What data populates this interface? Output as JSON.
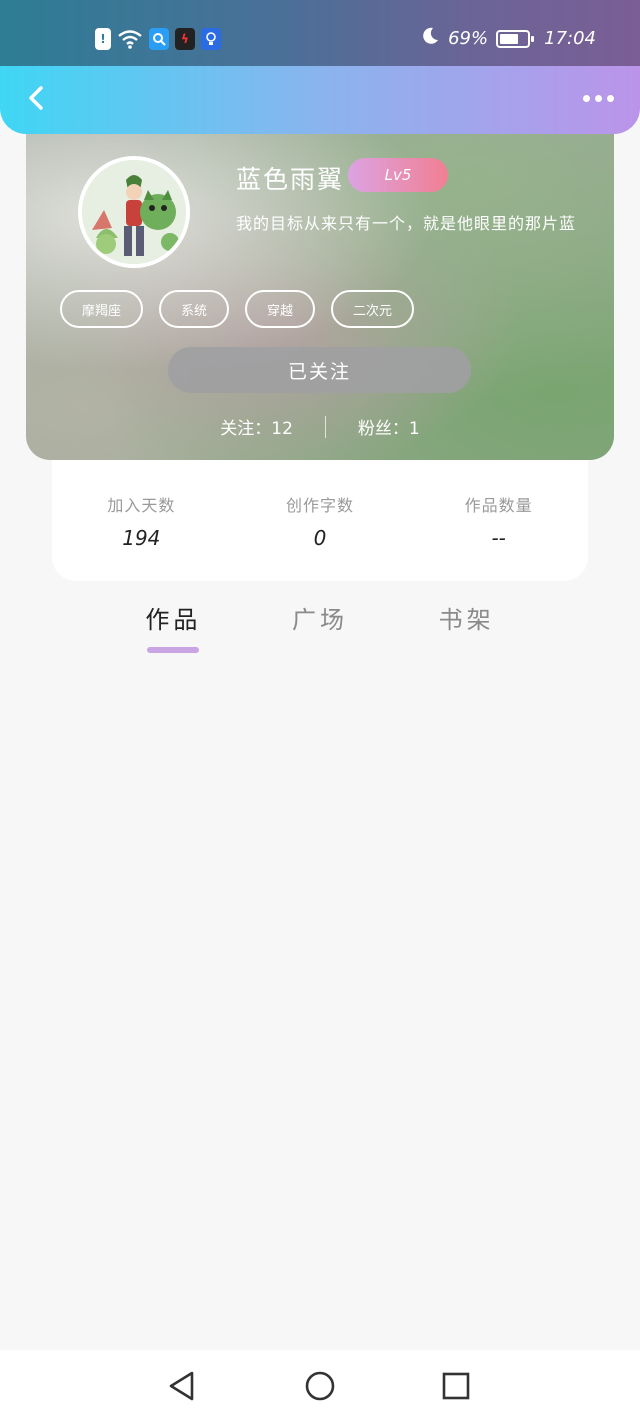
{
  "status_bar": {
    "battery_percent_text": "69%",
    "battery_level": 0.69,
    "time": "17:04",
    "icons": [
      "alert-icon",
      "wifi-icon",
      "search-app-icon",
      "lightning-app-icon",
      "bulb-app-icon",
      "moon-icon",
      "battery-icon"
    ]
  },
  "nav": {
    "icons": [
      "back-chevron-icon",
      "more-dots-icon"
    ]
  },
  "profile": {
    "username": "蓝色雨翼",
    "level": "Lv5",
    "bio": "我的目标从来只有一个，就是他眼里的那片蓝",
    "tags": [
      "摩羯座",
      "系统",
      "穿越",
      "二次元"
    ],
    "follow_button_label": "已关注",
    "following_text": "关注：12",
    "followers_text": "粉丝：1"
  },
  "stats": [
    {
      "label": "加入天数",
      "value": "194"
    },
    {
      "label": "创作字数",
      "value": "0"
    },
    {
      "label": "作品数量",
      "value": "--"
    }
  ],
  "tabs": [
    {
      "label": "作品",
      "active": true
    },
    {
      "label": "广场",
      "active": false
    },
    {
      "label": "书架",
      "active": false
    }
  ],
  "colors": {
    "nav_gradient_start": "#3fd6f4",
    "nav_gradient_end": "#bb94e9",
    "level_gradient_start": "#dca3e2",
    "level_gradient_end": "#f17f92",
    "tab_indicator": "#c9a6e3"
  }
}
